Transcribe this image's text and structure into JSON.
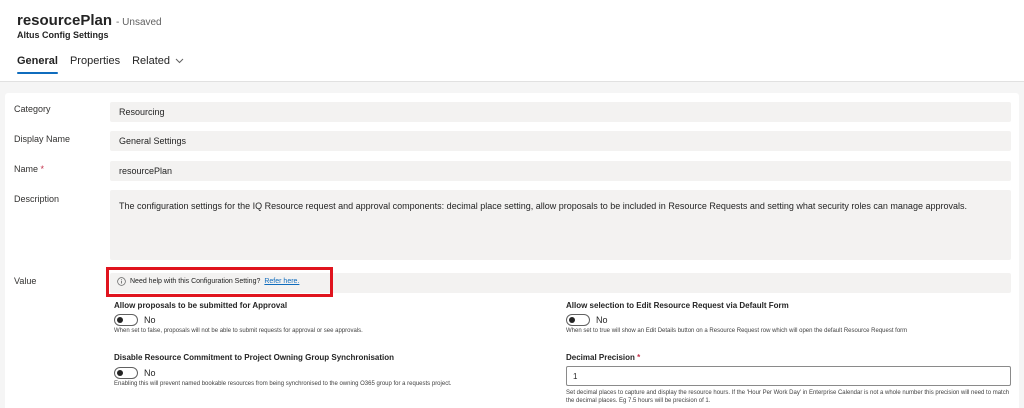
{
  "header": {
    "title": "resourcePlan",
    "status": "- Unsaved",
    "subtitle": "Altus Config Settings",
    "tabs": [
      {
        "label": "General",
        "active": true
      },
      {
        "label": "Properties",
        "active": false
      },
      {
        "label": "Related",
        "active": false,
        "has_dropdown": true
      }
    ]
  },
  "form": {
    "category": {
      "label": "Category",
      "value": "Resourcing"
    },
    "display_name": {
      "label": "Display Name",
      "value": "General Settings"
    },
    "name": {
      "label": "Name",
      "required_mark": "*",
      "value": "resourcePlan"
    },
    "description": {
      "label": "Description",
      "value": "The configuration settings for the IQ Resource request and approval components: decimal place setting, allow proposals to be included in Resource Requests and setting what security roles can manage approvals."
    },
    "value": {
      "label": "Value"
    }
  },
  "help": {
    "icon": "info-icon",
    "text": "Need help with this Configuration Setting?",
    "link": "Refer here."
  },
  "settings": {
    "allow_proposals": {
      "title": "Allow proposals to be submitted for Approval",
      "toggle_label": "No",
      "enabled": false,
      "description": "When set to false, proposals will not be able to submit requests for approval or see approvals."
    },
    "allow_edit": {
      "title": "Allow selection to Edit Resource Request via Default Form",
      "toggle_label": "No",
      "enabled": false,
      "description": "When set to true will show an Edit Details button on a Resource Request row which will open the default Resource Request form"
    },
    "disable_commitment": {
      "title": "Disable Resource Commitment to Project Owning Group Synchronisation",
      "toggle_label": "No",
      "enabled": false,
      "description": "Enabling this will prevent named bookable resources from being synchronised to the owning O365 group for a requests project."
    },
    "decimal_precision": {
      "title": "Decimal Precision",
      "required_mark": "*",
      "value": "1",
      "description": "Set decimal places  to capture and display the resource hours. If the 'Hour Per Work Day' in Enterprise Calendar is not a whole number this precision will need to match the decimal places. Eg 7.5 hours will be precision of 1."
    }
  },
  "colors": {
    "accent": "#0f6cbd",
    "highlight": "#e0141e",
    "field_bg": "#f3f2f1",
    "required": "#c4314b"
  }
}
